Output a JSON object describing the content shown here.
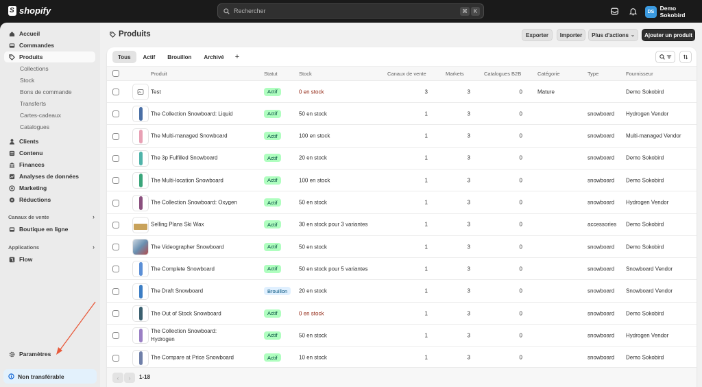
{
  "topbar": {
    "brand": "shopify",
    "search_placeholder": "Rechercher",
    "shortcut_keys": [
      "⌘",
      "K"
    ],
    "store_initials": "DS",
    "store_name": "Demo Sokobird"
  },
  "sidebar": {
    "items": [
      {
        "label": "Accueil",
        "icon": "home-icon"
      },
      {
        "label": "Commandes",
        "icon": "inbox-icon"
      },
      {
        "label": "Produits",
        "icon": "tag-icon",
        "active": true
      }
    ],
    "product_subitems": [
      "Collections",
      "Stock",
      "Bons de commande",
      "Transferts",
      "Cartes-cadeaux",
      "Catalogues"
    ],
    "items2": [
      {
        "label": "Clients",
        "icon": "person-icon"
      },
      {
        "label": "Contenu",
        "icon": "content-icon"
      },
      {
        "label": "Finances",
        "icon": "bank-icon"
      },
      {
        "label": "Analyses de données",
        "icon": "chart-icon"
      },
      {
        "label": "Marketing",
        "icon": "target-icon"
      },
      {
        "label": "Réductions",
        "icon": "discount-icon"
      }
    ],
    "sales_channels_label": "Canaux de vente",
    "online_store": "Boutique en ligne",
    "apps_label": "Applications",
    "flow": "Flow",
    "settings": "Paramètres",
    "status": "Non transférable"
  },
  "page": {
    "title": "Produits",
    "actions": {
      "export": "Exporter",
      "import": "Importer",
      "more": "Plus d'actions",
      "add": "Ajouter un produit"
    },
    "tabs": [
      "Tous",
      "Actif",
      "Brouillon",
      "Archivé"
    ],
    "add_tab": "+"
  },
  "table": {
    "headers": {
      "product": "Produit",
      "status": "Statut",
      "stock": "Stock",
      "channels": "Canaux de vente",
      "markets": "Markets",
      "b2b": "Catalogues B2B",
      "category": "Catégorie",
      "type": "Type",
      "vendor": "Fournisseur"
    },
    "rows": [
      {
        "name": "Test",
        "status": "Actif",
        "stock": "0 en stock",
        "out": true,
        "channels": "3",
        "markets": "3",
        "b2b": "0",
        "category": "Mature",
        "type": "",
        "vendor": "Demo Sokobird",
        "thumb": "placeholder",
        "color": "#888888"
      },
      {
        "name": "The Collection Snowboard: Liquid",
        "status": "Actif",
        "stock": "50 en stock",
        "out": false,
        "channels": "1",
        "markets": "3",
        "b2b": "0",
        "category": "",
        "type": "snowboard",
        "vendor": "Hydrogen Vendor",
        "thumb": "board",
        "color": "#4a6fa5"
      },
      {
        "name": "The Multi-managed Snowboard",
        "status": "Actif",
        "stock": "100 en stock",
        "out": false,
        "channels": "1",
        "markets": "3",
        "b2b": "0",
        "category": "",
        "type": "snowboard",
        "vendor": "Multi-managed Vendor",
        "thumb": "board",
        "color": "#e8a0b4"
      },
      {
        "name": "The 3p Fulfilled Snowboard",
        "status": "Actif",
        "stock": "20 en stock",
        "out": false,
        "channels": "1",
        "markets": "3",
        "b2b": "0",
        "category": "",
        "type": "snowboard",
        "vendor": "Demo Sokobird",
        "thumb": "board",
        "color": "#4fb3a9"
      },
      {
        "name": "The Multi-location Snowboard",
        "status": "Actif",
        "stock": "100 en stock",
        "out": false,
        "channels": "1",
        "markets": "3",
        "b2b": "0",
        "category": "",
        "type": "snowboard",
        "vendor": "Demo Sokobird",
        "thumb": "board",
        "color": "#3aa57a"
      },
      {
        "name": "The Collection Snowboard: Oxygen",
        "status": "Actif",
        "stock": "50 en stock",
        "out": false,
        "channels": "1",
        "markets": "3",
        "b2b": "0",
        "category": "",
        "type": "snowboard",
        "vendor": "Hydrogen Vendor",
        "thumb": "board",
        "color": "#8a4f7d"
      },
      {
        "name": "Selling Plans Ski Wax",
        "status": "Actif",
        "stock": "30 en stock pour 3 variantes",
        "out": false,
        "channels": "1",
        "markets": "3",
        "b2b": "0",
        "category": "",
        "type": "accessories",
        "vendor": "Demo Sokobird",
        "thumb": "wax",
        "color": "#c8a25a"
      },
      {
        "name": "The Videographer Snowboard",
        "status": "Actif",
        "stock": "50 en stock",
        "out": false,
        "channels": "1",
        "markets": "3",
        "b2b": "0",
        "category": "",
        "type": "snowboard",
        "vendor": "Demo Sokobird",
        "thumb": "photo",
        "color": "#6a8fb0"
      },
      {
        "name": "The Complete Snowboard",
        "status": "Actif",
        "stock": "50 en stock pour 5 variantes",
        "out": false,
        "channels": "1",
        "markets": "3",
        "b2b": "0",
        "category": "",
        "type": "snowboard",
        "vendor": "Snowboard Vendor",
        "thumb": "board",
        "color": "#5b8fd6"
      },
      {
        "name": "The Draft Snowboard",
        "status": "Brouillon",
        "stock": "20 en stock",
        "out": false,
        "channels": "1",
        "markets": "3",
        "b2b": "0",
        "category": "",
        "type": "snowboard",
        "vendor": "Snowboard Vendor",
        "thumb": "board",
        "color": "#3b7dc4"
      },
      {
        "name": "The Out of Stock Snowboard",
        "status": "Actif",
        "stock": "0 en stock",
        "out": true,
        "channels": "1",
        "markets": "3",
        "b2b": "0",
        "category": "",
        "type": "snowboard",
        "vendor": "Demo Sokobird",
        "thumb": "board",
        "color": "#3a5f6f"
      },
      {
        "name": "The Collection Snowboard: Hydrogen",
        "status": "Actif",
        "stock": "50 en stock",
        "out": false,
        "channels": "1",
        "markets": "3",
        "b2b": "0",
        "category": "",
        "type": "snowboard",
        "vendor": "Hydrogen Vendor",
        "thumb": "board",
        "color": "#9a7fc4"
      },
      {
        "name": "The Compare at Price Snowboard",
        "status": "Actif",
        "stock": "10 en stock",
        "out": false,
        "channels": "1",
        "markets": "3",
        "b2b": "0",
        "category": "",
        "type": "snowboard",
        "vendor": "Demo Sokobird",
        "thumb": "board",
        "color": "#6f7fa8"
      }
    ]
  },
  "pagination": {
    "range": "1-18",
    "prev": "‹",
    "next": "›"
  },
  "colors": {
    "topbar": "#1a1a1a",
    "sidebar": "#ebebeb",
    "active_badge": "#affebf",
    "draft_badge": "#e0f0ff",
    "out_of_stock": "#8e1f0b",
    "annotation_arrow": "#e8593a"
  }
}
